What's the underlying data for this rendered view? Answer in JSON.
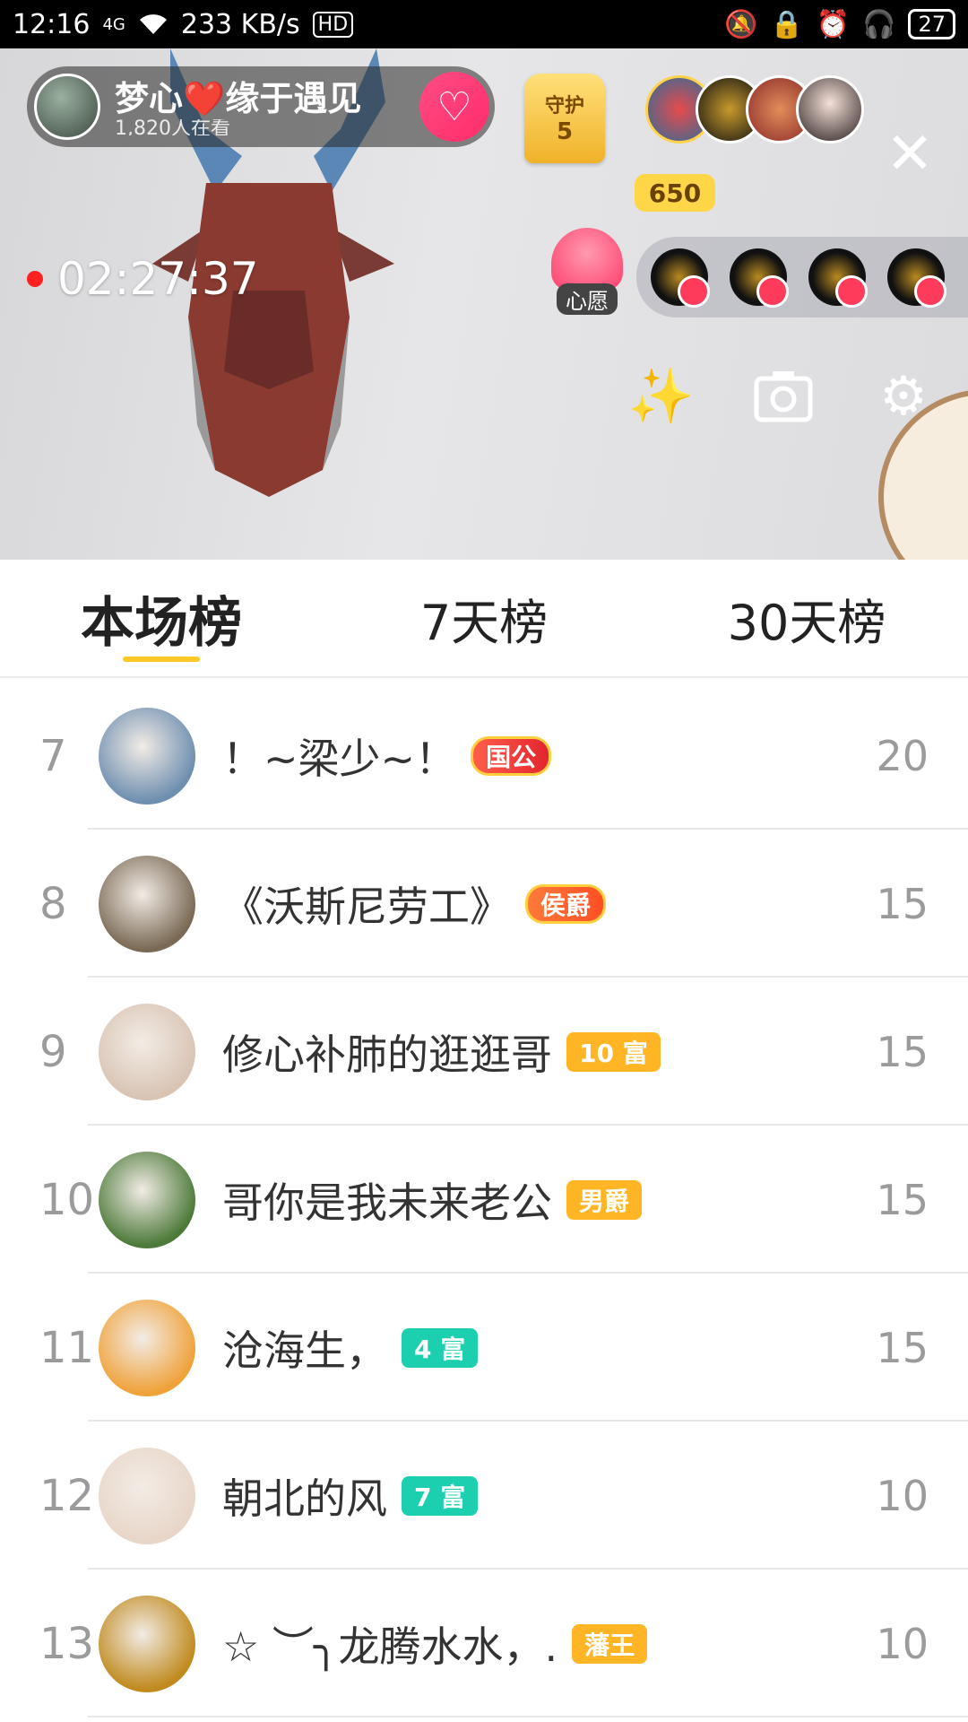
{
  "status_bar": {
    "time": "12:16",
    "network": "4G",
    "speed": "233 KB/s",
    "hd": "HD",
    "battery": "27"
  },
  "live": {
    "host_name": "梦心❤️缘于遇见",
    "viewers": "1,820人在看",
    "guard_label": "守护",
    "guard_count": "5",
    "audience_count": "650",
    "timer": "02:27:37",
    "wish_label": "心愿"
  },
  "tabs": [
    {
      "label": "本场榜",
      "active": true
    },
    {
      "label": "7天榜",
      "active": false
    },
    {
      "label": "30天榜",
      "active": false
    }
  ],
  "ranking": [
    {
      "rank": "7",
      "name": "！~梁少~！",
      "badge": "国公",
      "badge_style": "red",
      "score": "20",
      "avatar_color": "#6f8fb0"
    },
    {
      "rank": "8",
      "name": "《沃斯尼劳工》",
      "badge": "侯爵",
      "badge_style": "orange",
      "score": "15",
      "avatar_color": "#7a6a55"
    },
    {
      "rank": "9",
      "name": "修心补肺的逛逛哥",
      "badge": "10 富",
      "badge_style": "gold",
      "score": "15",
      "avatar_color": "#d9c4b4"
    },
    {
      "rank": "10",
      "name": "哥你是我未来老公",
      "badge": "男爵",
      "badge_style": "gold",
      "score": "15",
      "avatar_color": "#4d7a3a"
    },
    {
      "rank": "11",
      "name": "沧海生，",
      "badge": "4 富",
      "badge_style": "teal",
      "score": "15",
      "avatar_color": "#f0a23a"
    },
    {
      "rank": "12",
      "name": "朝北的风",
      "badge": "7 富",
      "badge_style": "teal",
      "score": "10",
      "avatar_color": "#e8d6c8"
    },
    {
      "rank": "13",
      "name": "☆ ︶╮龙腾水水，.",
      "badge": "藩王",
      "badge_style": "gold",
      "score": "10",
      "avatar_color": "#c08a1e"
    }
  ]
}
